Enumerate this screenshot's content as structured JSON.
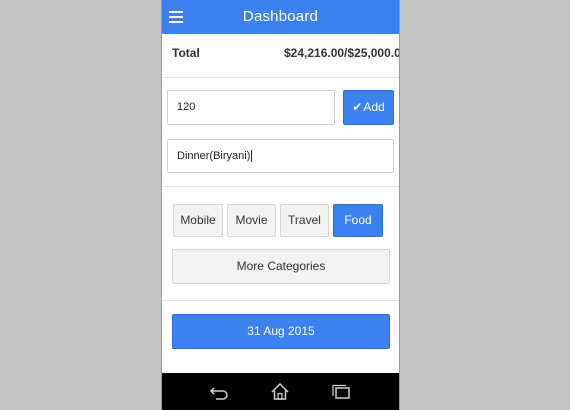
{
  "appbar": {
    "title": "Dashboard",
    "menu_icon": "hamburger-menu-icon"
  },
  "summary": {
    "total_label": "Total",
    "total_value": "$24,216.00/$25,000.0"
  },
  "form": {
    "amount_value": "120",
    "add_label": "Add",
    "add_icon": "check-icon",
    "description_value": "Dinner(Biryani)"
  },
  "categories": {
    "items": [
      {
        "label": "Mobile",
        "selected": false
      },
      {
        "label": "Movie",
        "selected": false
      },
      {
        "label": "Travel",
        "selected": false
      },
      {
        "label": "Food",
        "selected": true
      }
    ],
    "more_label": "More Categories"
  },
  "date": {
    "label": "31 Aug 2015"
  },
  "navbar": {
    "icons": [
      "back-icon",
      "home-icon",
      "recent-apps-icon"
    ]
  },
  "colors": {
    "accent": "#3b82f0",
    "background": "#c3c3c3",
    "navbar": "#000000"
  }
}
